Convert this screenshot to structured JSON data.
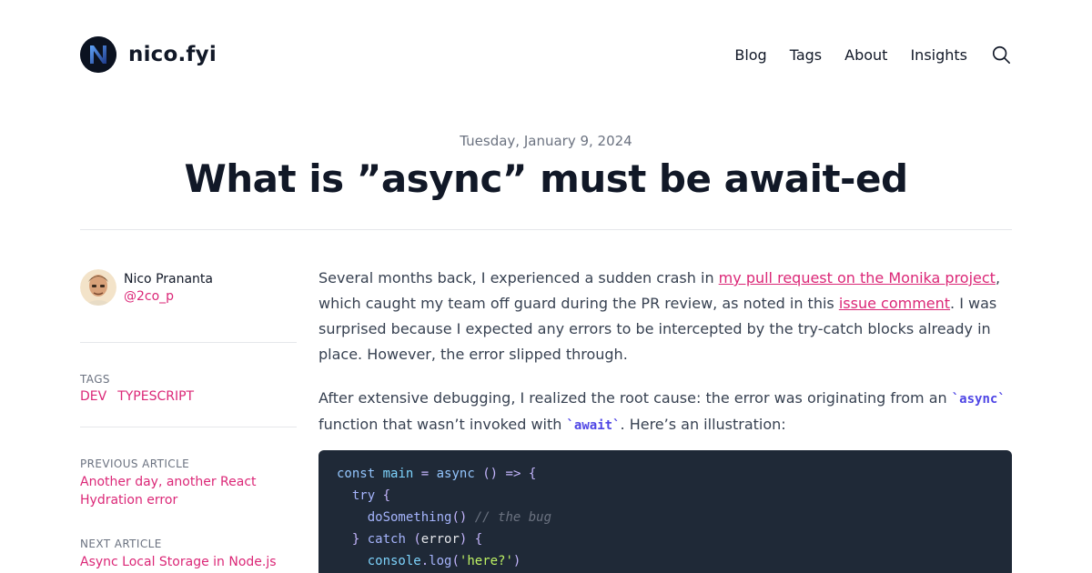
{
  "site": {
    "name": "nico.fyi",
    "nav": [
      "Blog",
      "Tags",
      "About",
      "Insights"
    ]
  },
  "post": {
    "date": "Tuesday, January 9, 2024",
    "title": "What is ”async” must be await-ed"
  },
  "author": {
    "name": "Nico Prananta",
    "handle": "@2co_p"
  },
  "sidebar": {
    "tags_label": "TAGS",
    "tags": [
      "DEV",
      "TYPESCRIPT"
    ],
    "previous_label": "PREVIOUS ARTICLE",
    "previous_title": "Another day, another React Hydration error",
    "next_label": "NEXT ARTICLE",
    "next_title": "Async Local Storage in Node.js"
  },
  "body": {
    "p1": {
      "t1": "Several months back, I experienced a sudden crash in ",
      "link1": "my pull request on the Monika project",
      "t2": ", which caught my team off guard during the PR review, as noted in this ",
      "link2": "issue comment",
      "t3": ". I was surprised because I expected any errors to be intercepted by the try-catch blocks already in place. However, the error slipped through."
    },
    "p2": {
      "t1": "After extensive debugging, I realized the root cause: the error was originating from an ",
      "code1": "`async`",
      "t2": " function that wasn’t invoked with ",
      "code2": "`await`",
      "t3": ". Here’s an illustration:"
    }
  },
  "code": {
    "l1": {
      "a": "const",
      "b": "main",
      "c": "=",
      "d": "async",
      "e": "()",
      "f": "=>",
      "g": "{"
    },
    "l2": {
      "a": "try",
      "b": "{"
    },
    "l3": {
      "a": "doSomething",
      "b": "()",
      "c": "// the bug"
    },
    "l4": {
      "a": "}",
      "b": "catch",
      "c": "(",
      "d": "error",
      "e": ")",
      "f": "{"
    },
    "l5": {
      "a": "console",
      "b": ".",
      "c": "log",
      "d": "(",
      "e": "'here?'",
      "f": ")"
    }
  },
  "colors": {
    "accent": "#db2777",
    "code_bg": "#1f2937",
    "inline_code": "#4f46e5"
  },
  "icons": {
    "search": "search-icon",
    "logo": "logo-icon"
  }
}
